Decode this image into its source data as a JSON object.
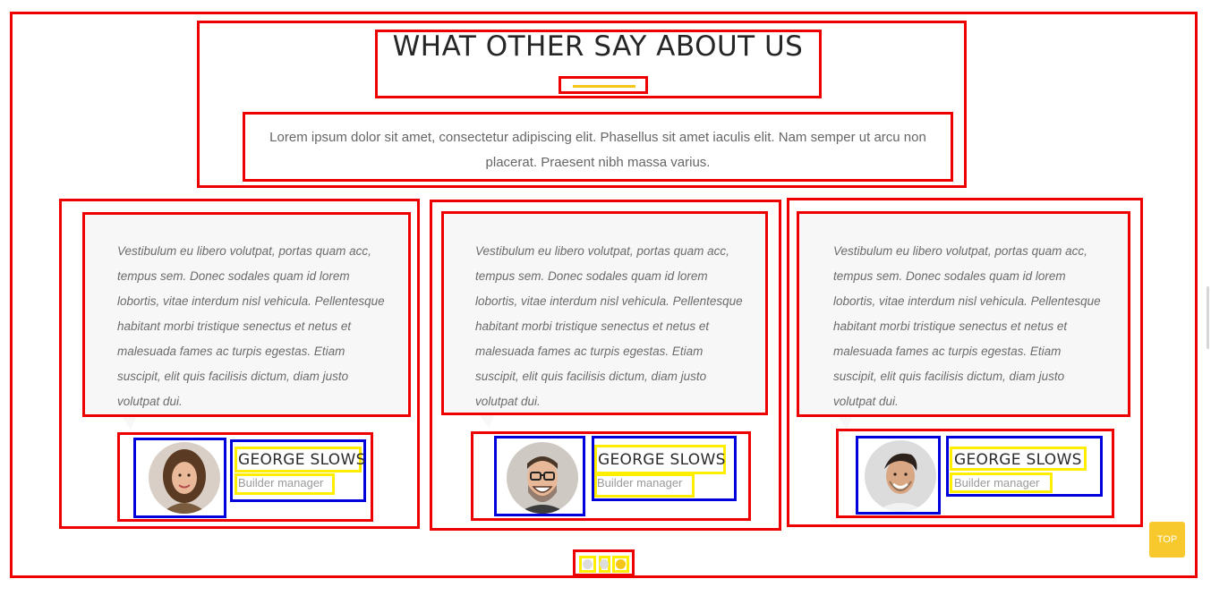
{
  "section": {
    "title": "WHAT OTHER SAY ABOUT US",
    "subtitle": "Lorem ipsum dolor sit amet, consectetur adipiscing elit. Phasellus sit amet iaculis elit. Nam semper ut arcu non placerat. Praesent nibh massa varius."
  },
  "testimonials": [
    {
      "quote": "Vestibulum eu libero volutpat, portas quam acc, tempus sem. Donec sodales quam id lorem lobortis, vitae interdum nisl vehicula. Pellentesque habitant morbi tristique senectus et netus et malesuada fames ac turpis egestas. Etiam suscipit, elit quis facilisis dictum, diam justo volutpat dui.",
      "name": "GEORGE SLOWS",
      "role": "Builder manager",
      "avatar_icon": "woman-portrait"
    },
    {
      "quote": "Vestibulum eu libero volutpat, portas quam acc, tempus sem. Donec sodales quam id lorem lobortis, vitae interdum nisl vehicula. Pellentesque habitant morbi tristique senectus et netus et malesuada fames ac turpis egestas. Etiam suscipit, elit quis facilisis dictum, diam justo volutpat dui.",
      "name": "GEORGE SLOWS",
      "role": "Builder manager",
      "avatar_icon": "man-glasses-portrait"
    },
    {
      "quote": "Vestibulum eu libero volutpat, portas quam acc, tempus sem. Donec sodales quam id lorem lobortis, vitae interdum nisl vehicula. Pellentesque habitant morbi tristique senectus et netus et malesuada fames ac turpis egestas. Etiam suscipit, elit quis facilisis dictum, diam justo volutpat dui.",
      "name": "GEORGE SLOWS",
      "role": "Builder manager",
      "avatar_icon": "man-portrait"
    }
  ],
  "pagination": {
    "count": 3,
    "active_index": 2
  },
  "top_button": {
    "label": "TOP"
  },
  "colors": {
    "accent": "#f5c518",
    "annotation_red": "#ee0000",
    "annotation_blue": "#0000dd",
    "annotation_yellow": "#ffee00"
  }
}
